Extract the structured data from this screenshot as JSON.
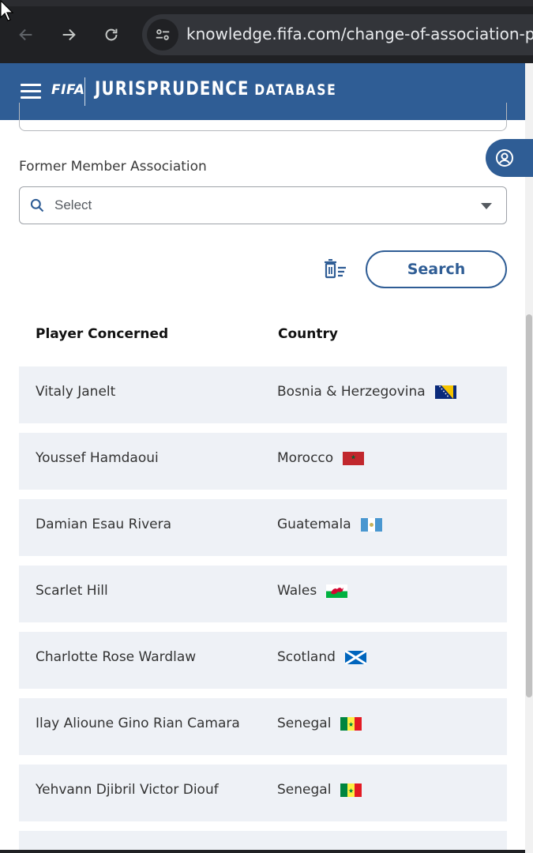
{
  "browser": {
    "url": "knowledge.fifa.com/change-of-association-plat"
  },
  "header": {
    "logo": "FIFA",
    "title_main": "JURISPRUDENCE",
    "title_sub": "DATABASE"
  },
  "filter": {
    "label": "Former Member Association",
    "placeholder": "Select"
  },
  "actions": {
    "search_label": "Search"
  },
  "table": {
    "columns": [
      "Player Concerned",
      "Country"
    ],
    "rows": [
      {
        "player": "Vitaly Janelt",
        "country": "Bosnia & Herzegovina",
        "flag": "bosnia"
      },
      {
        "player": "Youssef Hamdaoui",
        "country": "Morocco",
        "flag": "morocco"
      },
      {
        "player": "Damian Esau Rivera",
        "country": "Guatemala",
        "flag": "guatemala"
      },
      {
        "player": "Scarlet Hill",
        "country": "Wales",
        "flag": "wales"
      },
      {
        "player": "Charlotte Rose Wardlaw",
        "country": "Scotland",
        "flag": "scotland"
      },
      {
        "player": "Ilay Alioune Gino Rian Camara",
        "country": "Senegal",
        "flag": "senegal"
      },
      {
        "player": "Yehvann Djibril Victor Diouf",
        "country": "Senegal",
        "flag": "senegal"
      }
    ]
  },
  "colors": {
    "brand": "#2f5d95",
    "row_bg": "#eef1f6"
  }
}
